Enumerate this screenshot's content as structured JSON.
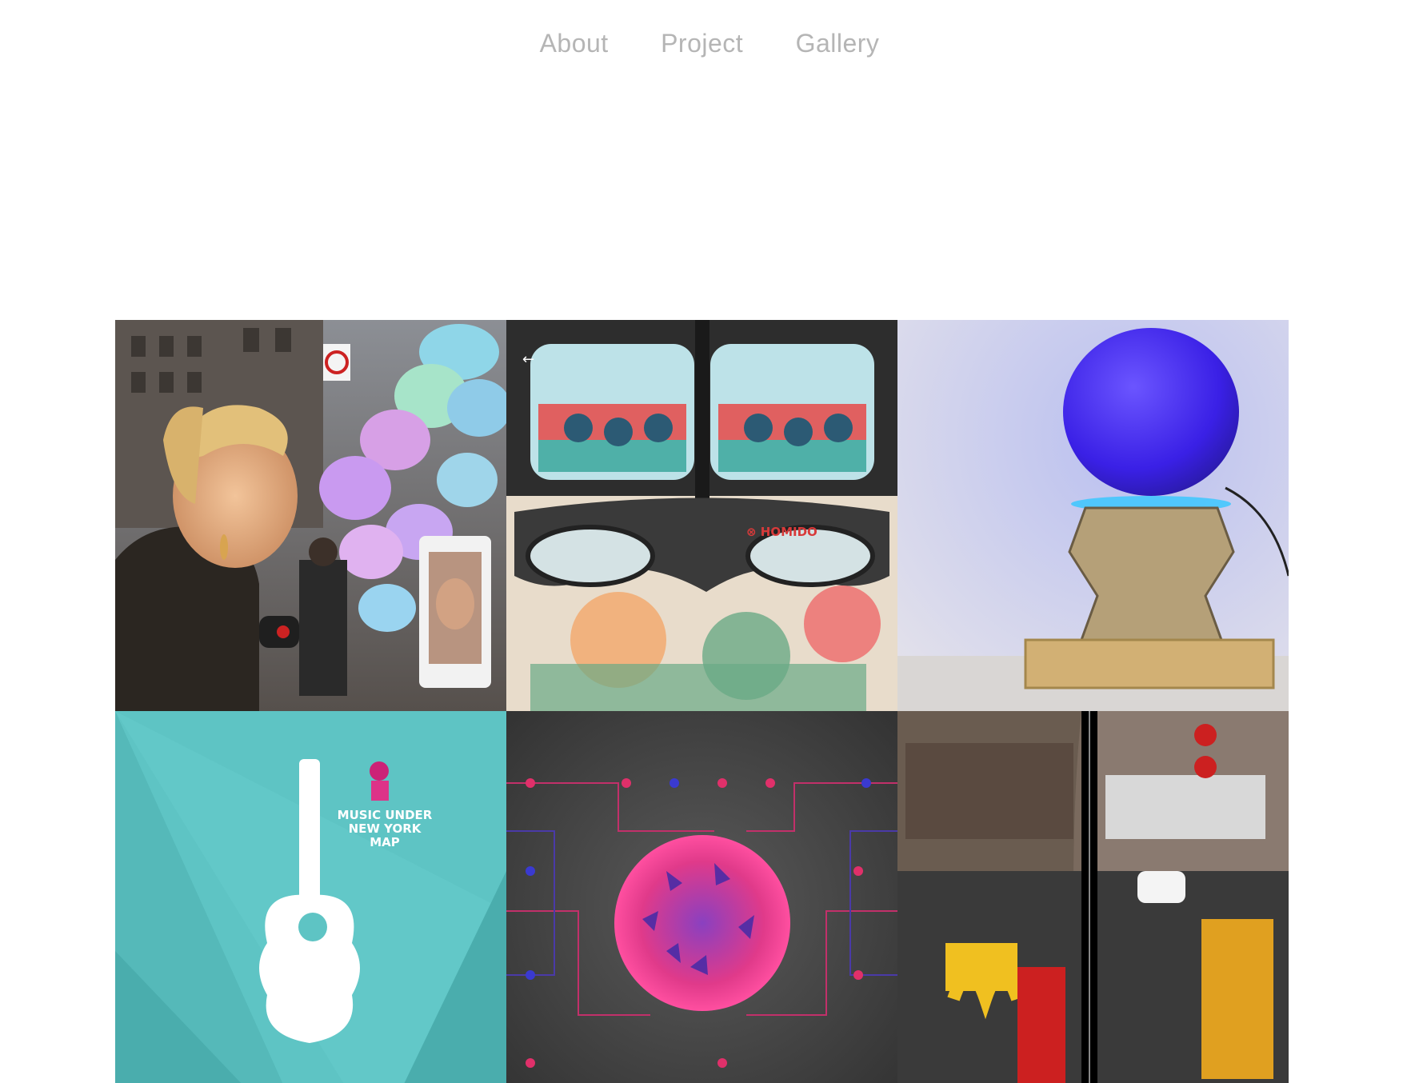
{
  "nav": {
    "items": [
      {
        "label": "About"
      },
      {
        "label": "Project"
      },
      {
        "label": "Gallery"
      }
    ]
  },
  "gallery": {
    "tiles": [
      {
        "subject": "street-cup-installation",
        "dominant_color": "#9aa0a8"
      },
      {
        "subject": "vr-headset-homido",
        "dominant_color": "#e7d9c8",
        "brand_text": "HOMIDO"
      },
      {
        "subject": "glowing-blue-orb-lamp",
        "dominant_color": "#4a3fe0"
      },
      {
        "subject": "music-under-new-york-map",
        "dominant_color": "#5bc3c3",
        "title_lines": [
          "MUSIC UNDER",
          "NEW YORK",
          "MAP"
        ]
      },
      {
        "subject": "particle-sphere-visual",
        "dominant_color": "#4a4a4a"
      },
      {
        "subject": "vr-stereo-street-view",
        "dominant_color": "#1b1b1b"
      }
    ]
  }
}
